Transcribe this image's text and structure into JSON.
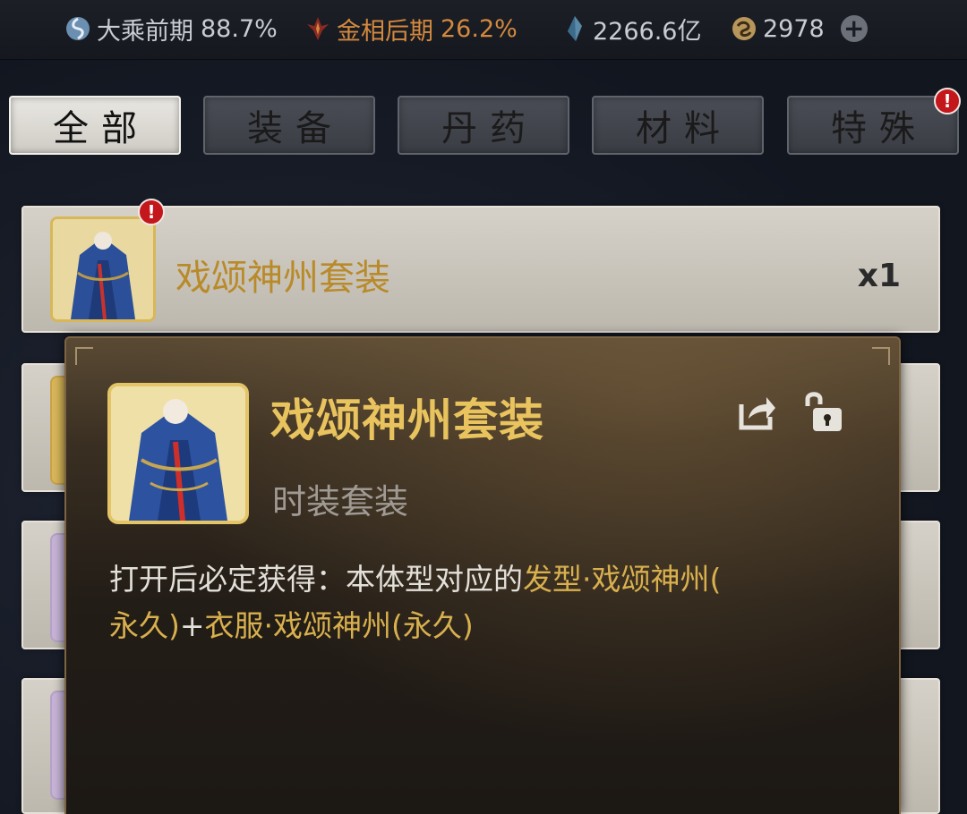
{
  "resources": {
    "realm": {
      "icon": "realm-swirl-icon",
      "label": "大乘前期",
      "value": "88.7%"
    },
    "body_realm": {
      "icon": "flame-sigil-icon",
      "label": "金相后期",
      "value": "26.2%"
    },
    "spirit_stones": {
      "icon": "spirit-crystal-icon",
      "value": "2266.6亿"
    },
    "jade": {
      "icon": "jade-coin-icon",
      "value": "2978"
    },
    "add_icon": "plus-icon"
  },
  "tabs": [
    {
      "label": "全部",
      "active": true
    },
    {
      "label": "装备",
      "active": false
    },
    {
      "label": "丹药",
      "active": false
    },
    {
      "label": "材料",
      "active": false
    },
    {
      "label": "特殊",
      "active": false,
      "badge": "!"
    }
  ],
  "items": [
    {
      "name": "戏颂神州套装",
      "qty": "x1",
      "badge": "!"
    }
  ],
  "popup": {
    "title": "戏颂神州套装",
    "subtitle": "时装套装",
    "share_icon": "share-icon",
    "lock_icon": "unlock-icon",
    "desc_prefix": "打开后必定获得：本体型对应的",
    "desc_item1": "发型·戏颂神州(",
    "desc_item1_tail": "永久)",
    "desc_plus": "+",
    "desc_item2": "衣服·戏颂神州(永久)"
  },
  "colors": {
    "accent_gold": "#e8c35e",
    "highlight": "#d9b04e",
    "badge_red": "#c3171c",
    "realm_orange": "#d4893e"
  }
}
